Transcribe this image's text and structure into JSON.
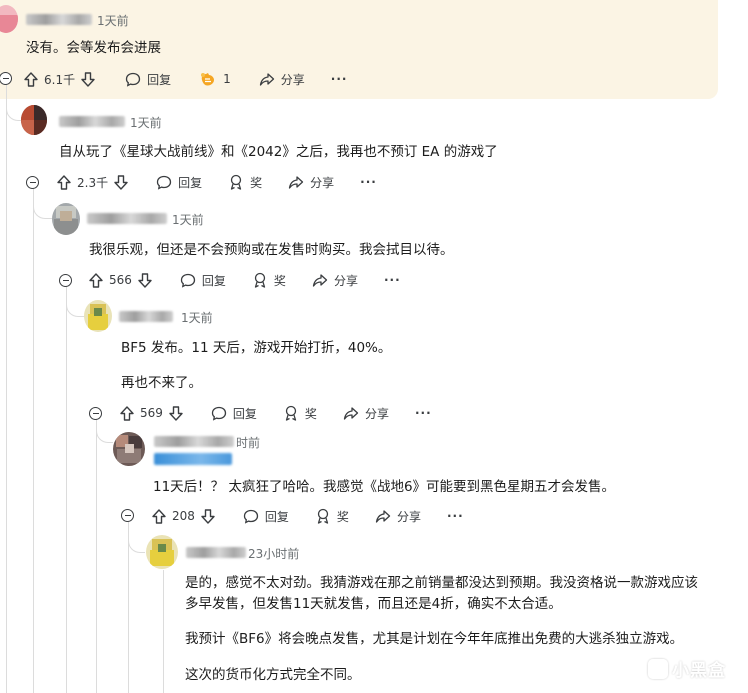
{
  "labels": {
    "reply": "回复",
    "award": "奖",
    "share": "分享",
    "more": "···"
  },
  "comments": [
    {
      "time": "1天前",
      "paragraphs": [
        "没有。会等发布会进展"
      ],
      "votes": "6.1千",
      "award_count": "1"
    },
    {
      "time": "1天前",
      "paragraphs": [
        "自从玩了《星球大战前线》和《2042》之后，我再也不预订 EA 的游戏了"
      ],
      "votes": "2.3千"
    },
    {
      "time": "1天前",
      "paragraphs": [
        "我很乐观，但还是不会预购或在发售时购买。我会拭目以待。"
      ],
      "votes": "566"
    },
    {
      "time": "1天前",
      "paragraphs": [
        "BF5 发布。11 天后，游戏开始打折，40%。",
        "再也不来了。"
      ],
      "votes": "569"
    },
    {
      "time": "时前",
      "paragraphs": [
        "11天后！？ 太疯狂了哈哈。我感觉《战地6》可能要到黑色星期五才会发售。"
      ],
      "votes": "208"
    },
    {
      "time": "23小时前",
      "paragraphs": [
        "是的，感觉不太对劲。我猜游戏在那之前销量都没达到预期。我没资格说一款游戏应该多早发售，但发售11天就发售，而且还是4折，确实不太合适。",
        "我预计《BF6》将会晚点发售，尤其是计划在今年年底推出免费的大逃杀独立游戏。",
        "这次的货币化方式完全不同。"
      ]
    }
  ],
  "watermark": "小黑盒",
  "colors": {
    "highlight_bg": "#fbf4e4",
    "award_icon": "#f5a623",
    "thread_line": "#dcdcdc"
  }
}
